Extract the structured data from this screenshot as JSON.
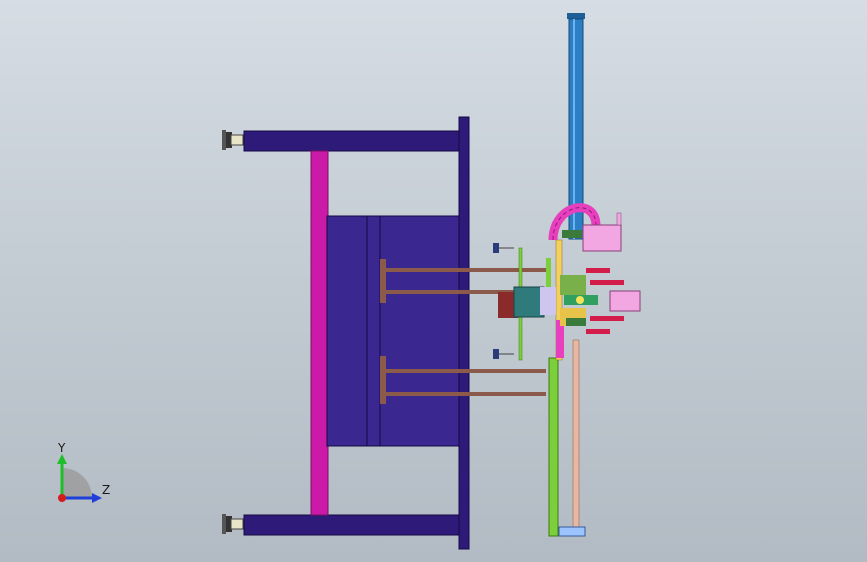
{
  "viewport": {
    "background_top": "#d6dde4",
    "background_bottom": "#b2bac3"
  },
  "colors": {
    "frame": "#2e1a78",
    "frame_edge": "#160a45",
    "mold_plate": "#3a2790",
    "magenta_post": "#cc1aa8",
    "blue_cylinder": "#2c7fc4",
    "pink_chain": "#e83fbf",
    "green_plate": "#7ccf3a",
    "rod_brown": "#8b5a4a",
    "light_pink": "#f2a6e2",
    "red_arm": "#d41c4a"
  },
  "triad": {
    "y_label": "Y",
    "z_label": "Z",
    "y_color": "#1fbf2a",
    "z_color": "#1f3fd8",
    "x_color": "#d41c1c"
  }
}
